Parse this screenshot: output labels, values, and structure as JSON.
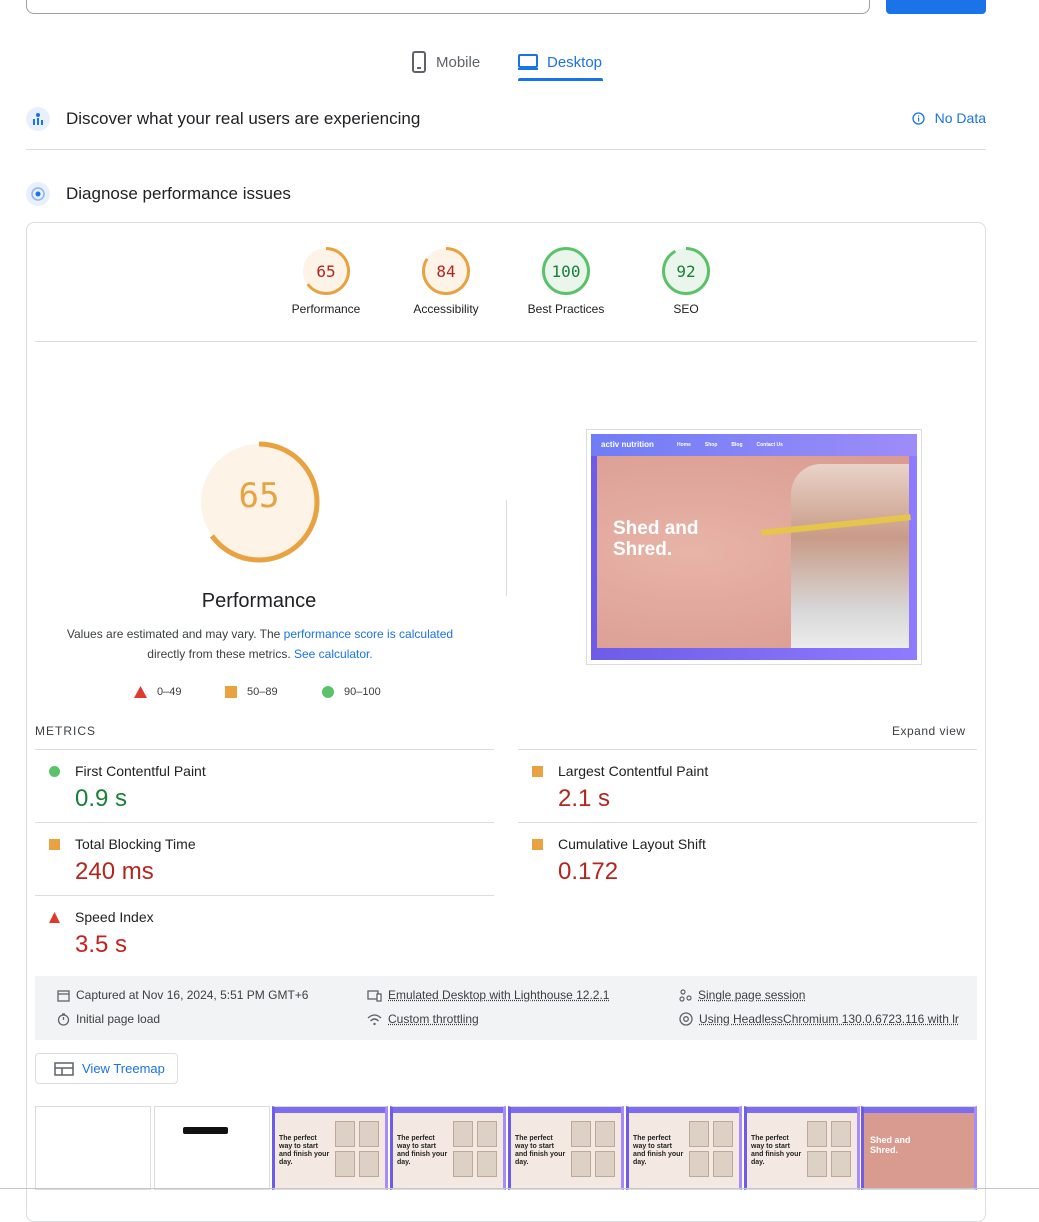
{
  "tabs": [
    {
      "label": "Mobile"
    },
    {
      "label": "Desktop"
    }
  ],
  "crux": {
    "title": "Discover what your real users are experiencing",
    "status": "No Data"
  },
  "diagnose": {
    "title": "Diagnose performance issues"
  },
  "scores": [
    {
      "label": "Performance",
      "value": "65",
      "fraction": 0.65,
      "color": "#e8a23f"
    },
    {
      "label": "Accessibility",
      "value": "84",
      "fraction": 0.84,
      "color": "#e8a23f"
    },
    {
      "label": "Best Practices",
      "value": "100",
      "fraction": 1.0,
      "color": "#5bc26a"
    },
    {
      "label": "SEO",
      "value": "92",
      "fraction": 0.92,
      "color": "#5bc26a"
    }
  ],
  "performance": {
    "score": "65",
    "fraction": 0.65,
    "title": "Performance",
    "desc_prefix": "Values are estimated and may vary. The ",
    "desc_link1": "performance score is calculated",
    "desc_mid": "directly from these metrics.",
    "desc_link2": "See calculator."
  },
  "legend": [
    {
      "range": "0–49",
      "shape": "triangle",
      "color": "#e03a2f"
    },
    {
      "range": "50–89",
      "shape": "square",
      "color": "#e8a23f"
    },
    {
      "range": "90–100",
      "shape": "circle",
      "color": "#5bc26a"
    }
  ],
  "screenshot": {
    "brand": "activ nutrition",
    "nav": [
      "Home",
      "Shop",
      "Blog",
      "Contact Us"
    ],
    "headline_1": "Shed and",
    "headline_2": "Shred."
  },
  "metrics": {
    "label": "METRICS",
    "expand": "Expand view",
    "items": [
      {
        "name": "First Contentful Paint",
        "value": "0.9 s",
        "rating": "good"
      },
      {
        "name": "Largest Contentful Paint",
        "value": "2.1 s",
        "rating": "average"
      },
      {
        "name": "Total Blocking Time",
        "value": "240 ms",
        "rating": "average"
      },
      {
        "name": "Cumulative Layout Shift",
        "value": "0.172",
        "rating": "average"
      },
      {
        "name": "Speed Index",
        "value": "3.5 s",
        "rating": "poor"
      }
    ]
  },
  "info": {
    "captured": "Captured at Nov 16, 2024, 5:51 PM GMT+6",
    "load": "Initial page load",
    "emulated": "Emulated Desktop with Lighthouse 12.2.1",
    "throttling": "Custom throttling",
    "session": "Single page session",
    "browser": "Using HeadlessChromium 130.0.6723.116 with lr"
  },
  "treemap": {
    "label": "View Treemap"
  },
  "filmstrip": {
    "caption": "The perfect way to start and finish your day.",
    "last_caption_1": "Shed and",
    "last_caption_2": "Shred."
  },
  "colors": {
    "accent": "#1a73e8",
    "good": "#188038",
    "poor": "#c5221f",
    "average_text": "#b3261e"
  }
}
